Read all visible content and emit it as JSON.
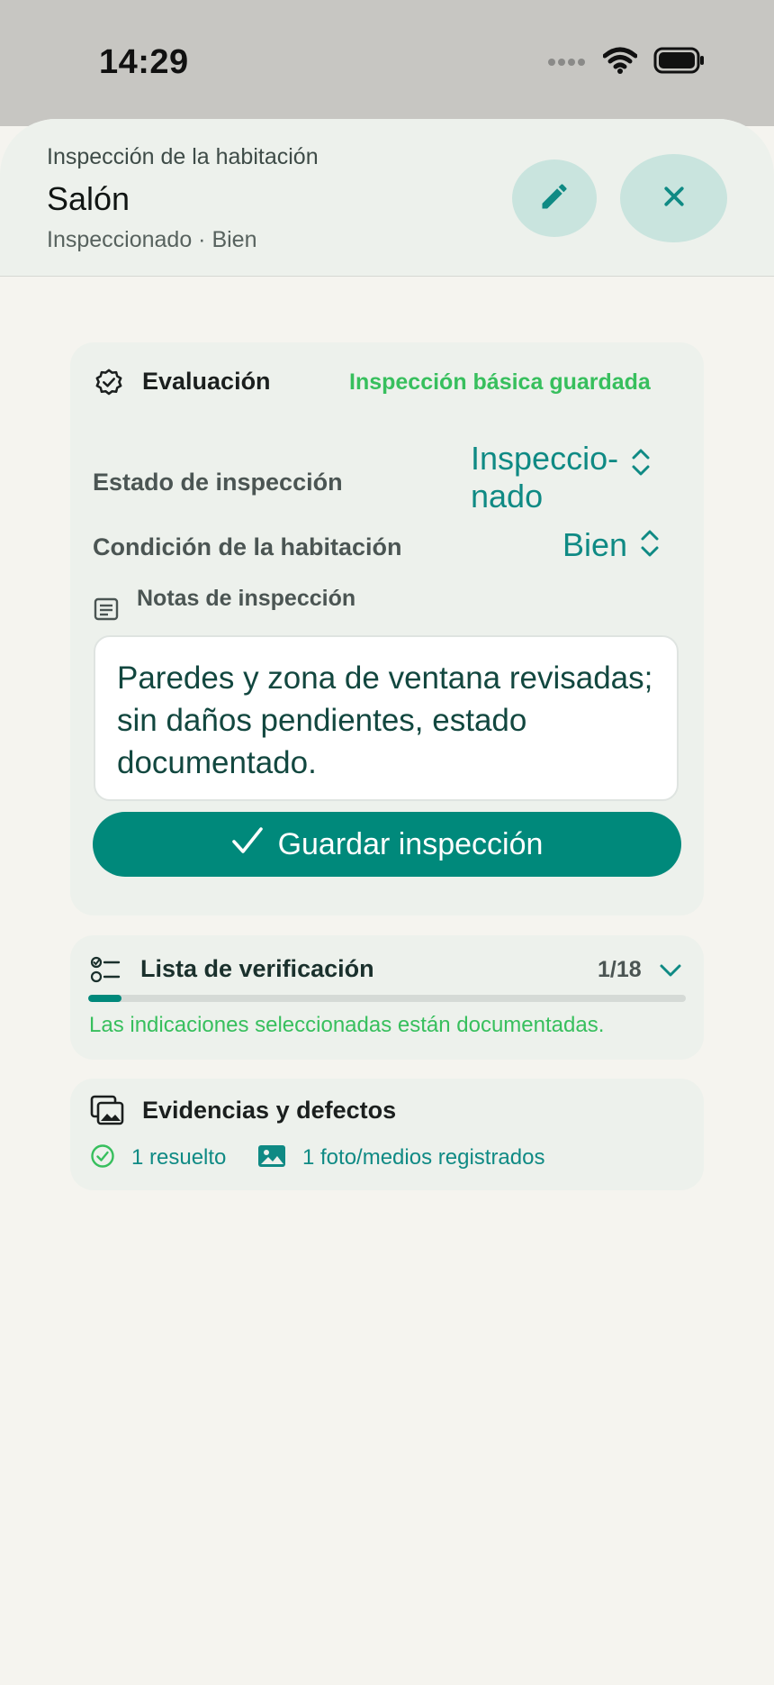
{
  "status_bar": {
    "time": "14:29"
  },
  "header": {
    "label": "Inspección de la habitación",
    "title": "Salón",
    "subtitle": "Inspeccionado · Bien"
  },
  "evaluation": {
    "title": "Evaluación",
    "saved_status": "Inspección básica guardada",
    "inspection_state_label": "Estado de inspección",
    "inspection_state_value_line1": "Inspeccio-",
    "inspection_state_value_line2": "nado",
    "room_condition_label": "Condición de la habitación",
    "room_condition_value": "Bien",
    "notes_label": "Notas de inspección",
    "notes_text": "Paredes y zona de ventana revisadas; sin daños pendientes, estado documentado.",
    "save_button_label": "Guardar inspección"
  },
  "checklist": {
    "title": "Lista de verificación",
    "count": "1/18",
    "progress_fraction": 0.0556,
    "note": "Las indicaciones seleccionadas están documentadas."
  },
  "evidence": {
    "title": "Evidencias y defectos",
    "resolved": "1 resuelto",
    "media": "1 foto/medios registrados"
  },
  "colors": {
    "accent": "#00897b",
    "accent_text": "#0f8a84",
    "success": "#37bf5d",
    "card_bg": "#edf1ec",
    "page_bg": "#f5f4ef"
  },
  "icons": {
    "wifi": "wifi-icon",
    "battery": "battery-icon",
    "edit": "pencil-icon",
    "close": "close-icon",
    "evaluation": "verified-badge-icon",
    "notes": "notes-icon",
    "save": "checkmark-icon",
    "checklist": "checklist-icon",
    "expand": "chevron-down-icon",
    "evidence": "photo-library-icon",
    "resolved": "check-circle-icon",
    "media": "image-icon"
  }
}
